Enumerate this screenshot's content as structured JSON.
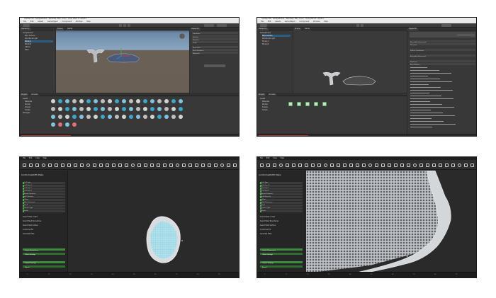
{
  "unity_editor": {
    "window_title": "Untitled 3D - SampleScene - Windows, Mac, Linux - Unity 2021.3 <DX11>",
    "menu": [
      "File",
      "Edit",
      "Assets",
      "GameObject",
      "Component",
      "Window",
      "Help"
    ],
    "tabs": {
      "hierarchy": "Hierarchy",
      "scene": "Scene",
      "game": "Game",
      "inspector": "Inspector",
      "project": "Project",
      "console": "Console"
    },
    "hierarchy_items": [
      "SampleScene",
      "Main Camera",
      "Directional Light",
      "Model_A",
      "Model_B",
      "Lattice",
      "Mesh"
    ],
    "selected_hierarchy_index": 3,
    "inspector_rows": [
      "Transform",
      "Position",
      "Rotation",
      "Scale",
      "Mesh Filter",
      "Mesh Renderer",
      "Materials"
    ],
    "project_folders": [
      "Assets",
      "Materials",
      "Models",
      "Scenes",
      "Scripts",
      "Packages"
    ],
    "inspector_text_lines": [
      "Assembly Information",
      "Filename",
      "Define Constraints",
      "Assembly References",
      "Platforms",
      "Any Platform"
    ],
    "colors": {
      "accent": "#2c5d87",
      "error": "#b0302c",
      "asset_cyan": "#3aa7c9"
    }
  },
  "slicer_app": {
    "menu": [
      "File",
      "Edit",
      "View",
      "Help"
    ],
    "sidebar_title": "Conformal/Infill Plate",
    "settings_rows": [
      "Cell Type",
      "Cell Size X",
      "Cell Size Y",
      "Cell Size Z",
      "Beam Diameter",
      "Infill Density",
      "Offset",
      "Wall Thickness",
      "Shell",
      "Lattice Type",
      "Scale"
    ],
    "sections": [
      "Select Plate or Part",
      "Select Mesh Boundaries",
      "Select Plate Surface",
      "Conformal Fill",
      "Generate Plate"
    ],
    "group_rows": [
      "Lattice Parameters",
      "Offset Settings",
      "Output Settings",
      "Export"
    ],
    "status_ticks": [
      "0",
      "10",
      "20",
      "30",
      "40",
      "50",
      "60",
      "70",
      "80",
      "90"
    ],
    "colors": {
      "group_green": "#3c8d3e",
      "plate_cyan": "#7fd0e0"
    }
  }
}
